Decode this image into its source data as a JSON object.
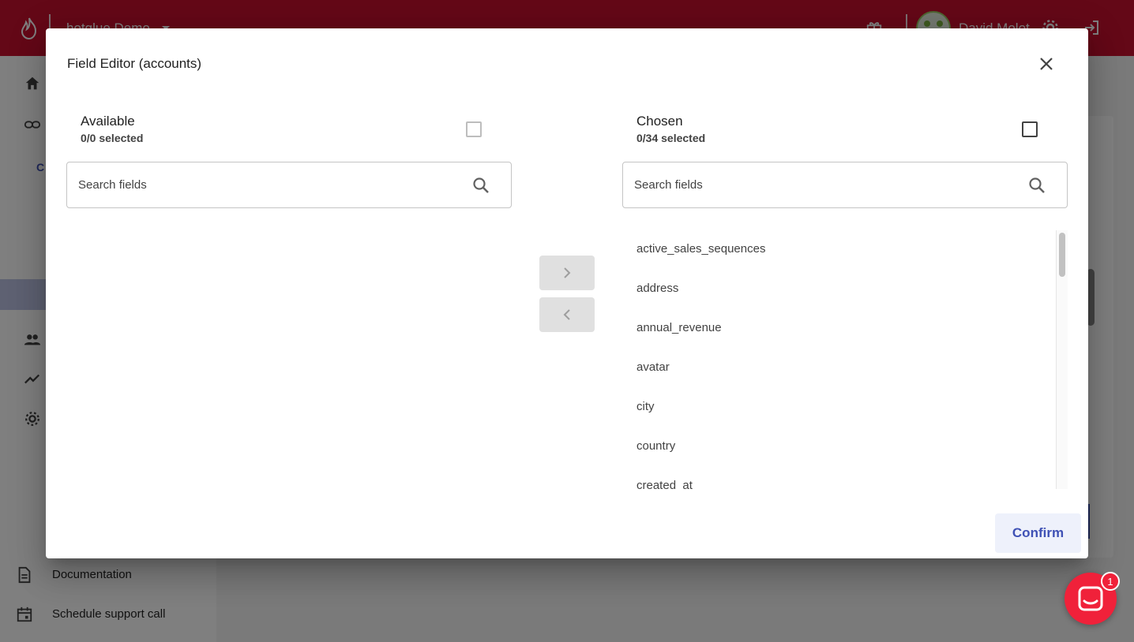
{
  "app": {
    "org_name": "hotglue Demo",
    "user_name": "David Molot",
    "brand_color": "#c8102e",
    "accent_color": "#3f51b5"
  },
  "sidebar": {
    "partial_item": "C",
    "links": [
      {
        "icon": "document-icon",
        "label": "Documentation"
      },
      {
        "icon": "calendar-icon",
        "label": "Schedule support call"
      }
    ]
  },
  "dialog": {
    "title": "Field Editor (accounts)",
    "available": {
      "title": "Available",
      "selected": "0/0 selected",
      "search_placeholder": "Search fields",
      "items": []
    },
    "chosen": {
      "title": "Chosen",
      "selected": "0/34 selected",
      "search_placeholder": "Search fields",
      "items": [
        "active_sales_sequences",
        "address",
        "annual_revenue",
        "avatar",
        "city",
        "country",
        "created_at"
      ]
    },
    "confirm_label": "Confirm"
  },
  "chat": {
    "badge": "1"
  }
}
